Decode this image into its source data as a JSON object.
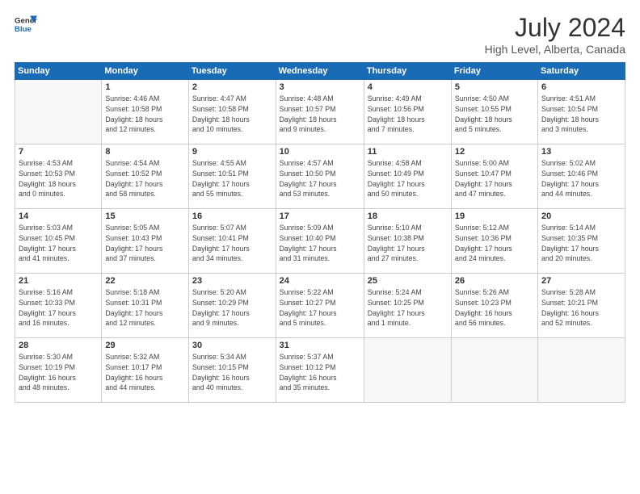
{
  "header": {
    "logo_line1": "General",
    "logo_line2": "Blue",
    "month_title": "July 2024",
    "location": "High Level, Alberta, Canada"
  },
  "days_of_week": [
    "Sunday",
    "Monday",
    "Tuesday",
    "Wednesday",
    "Thursday",
    "Friday",
    "Saturday"
  ],
  "weeks": [
    [
      {
        "day": "",
        "info": ""
      },
      {
        "day": "1",
        "info": "Sunrise: 4:46 AM\nSunset: 10:58 PM\nDaylight: 18 hours\nand 12 minutes."
      },
      {
        "day": "2",
        "info": "Sunrise: 4:47 AM\nSunset: 10:58 PM\nDaylight: 18 hours\nand 10 minutes."
      },
      {
        "day": "3",
        "info": "Sunrise: 4:48 AM\nSunset: 10:57 PM\nDaylight: 18 hours\nand 9 minutes."
      },
      {
        "day": "4",
        "info": "Sunrise: 4:49 AM\nSunset: 10:56 PM\nDaylight: 18 hours\nand 7 minutes."
      },
      {
        "day": "5",
        "info": "Sunrise: 4:50 AM\nSunset: 10:55 PM\nDaylight: 18 hours\nand 5 minutes."
      },
      {
        "day": "6",
        "info": "Sunrise: 4:51 AM\nSunset: 10:54 PM\nDaylight: 18 hours\nand 3 minutes."
      }
    ],
    [
      {
        "day": "7",
        "info": "Sunrise: 4:53 AM\nSunset: 10:53 PM\nDaylight: 18 hours\nand 0 minutes."
      },
      {
        "day": "8",
        "info": "Sunrise: 4:54 AM\nSunset: 10:52 PM\nDaylight: 17 hours\nand 58 minutes."
      },
      {
        "day": "9",
        "info": "Sunrise: 4:55 AM\nSunset: 10:51 PM\nDaylight: 17 hours\nand 55 minutes."
      },
      {
        "day": "10",
        "info": "Sunrise: 4:57 AM\nSunset: 10:50 PM\nDaylight: 17 hours\nand 53 minutes."
      },
      {
        "day": "11",
        "info": "Sunrise: 4:58 AM\nSunset: 10:49 PM\nDaylight: 17 hours\nand 50 minutes."
      },
      {
        "day": "12",
        "info": "Sunrise: 5:00 AM\nSunset: 10:47 PM\nDaylight: 17 hours\nand 47 minutes."
      },
      {
        "day": "13",
        "info": "Sunrise: 5:02 AM\nSunset: 10:46 PM\nDaylight: 17 hours\nand 44 minutes."
      }
    ],
    [
      {
        "day": "14",
        "info": "Sunrise: 5:03 AM\nSunset: 10:45 PM\nDaylight: 17 hours\nand 41 minutes."
      },
      {
        "day": "15",
        "info": "Sunrise: 5:05 AM\nSunset: 10:43 PM\nDaylight: 17 hours\nand 37 minutes."
      },
      {
        "day": "16",
        "info": "Sunrise: 5:07 AM\nSunset: 10:41 PM\nDaylight: 17 hours\nand 34 minutes."
      },
      {
        "day": "17",
        "info": "Sunrise: 5:09 AM\nSunset: 10:40 PM\nDaylight: 17 hours\nand 31 minutes."
      },
      {
        "day": "18",
        "info": "Sunrise: 5:10 AM\nSunset: 10:38 PM\nDaylight: 17 hours\nand 27 minutes."
      },
      {
        "day": "19",
        "info": "Sunrise: 5:12 AM\nSunset: 10:36 PM\nDaylight: 17 hours\nand 24 minutes."
      },
      {
        "day": "20",
        "info": "Sunrise: 5:14 AM\nSunset: 10:35 PM\nDaylight: 17 hours\nand 20 minutes."
      }
    ],
    [
      {
        "day": "21",
        "info": "Sunrise: 5:16 AM\nSunset: 10:33 PM\nDaylight: 17 hours\nand 16 minutes."
      },
      {
        "day": "22",
        "info": "Sunrise: 5:18 AM\nSunset: 10:31 PM\nDaylight: 17 hours\nand 12 minutes."
      },
      {
        "day": "23",
        "info": "Sunrise: 5:20 AM\nSunset: 10:29 PM\nDaylight: 17 hours\nand 9 minutes."
      },
      {
        "day": "24",
        "info": "Sunrise: 5:22 AM\nSunset: 10:27 PM\nDaylight: 17 hours\nand 5 minutes."
      },
      {
        "day": "25",
        "info": "Sunrise: 5:24 AM\nSunset: 10:25 PM\nDaylight: 17 hours\nand 1 minute."
      },
      {
        "day": "26",
        "info": "Sunrise: 5:26 AM\nSunset: 10:23 PM\nDaylight: 16 hours\nand 56 minutes."
      },
      {
        "day": "27",
        "info": "Sunrise: 5:28 AM\nSunset: 10:21 PM\nDaylight: 16 hours\nand 52 minutes."
      }
    ],
    [
      {
        "day": "28",
        "info": "Sunrise: 5:30 AM\nSunset: 10:19 PM\nDaylight: 16 hours\nand 48 minutes."
      },
      {
        "day": "29",
        "info": "Sunrise: 5:32 AM\nSunset: 10:17 PM\nDaylight: 16 hours\nand 44 minutes."
      },
      {
        "day": "30",
        "info": "Sunrise: 5:34 AM\nSunset: 10:15 PM\nDaylight: 16 hours\nand 40 minutes."
      },
      {
        "day": "31",
        "info": "Sunrise: 5:37 AM\nSunset: 10:12 PM\nDaylight: 16 hours\nand 35 minutes."
      },
      {
        "day": "",
        "info": ""
      },
      {
        "day": "",
        "info": ""
      },
      {
        "day": "",
        "info": ""
      }
    ]
  ]
}
